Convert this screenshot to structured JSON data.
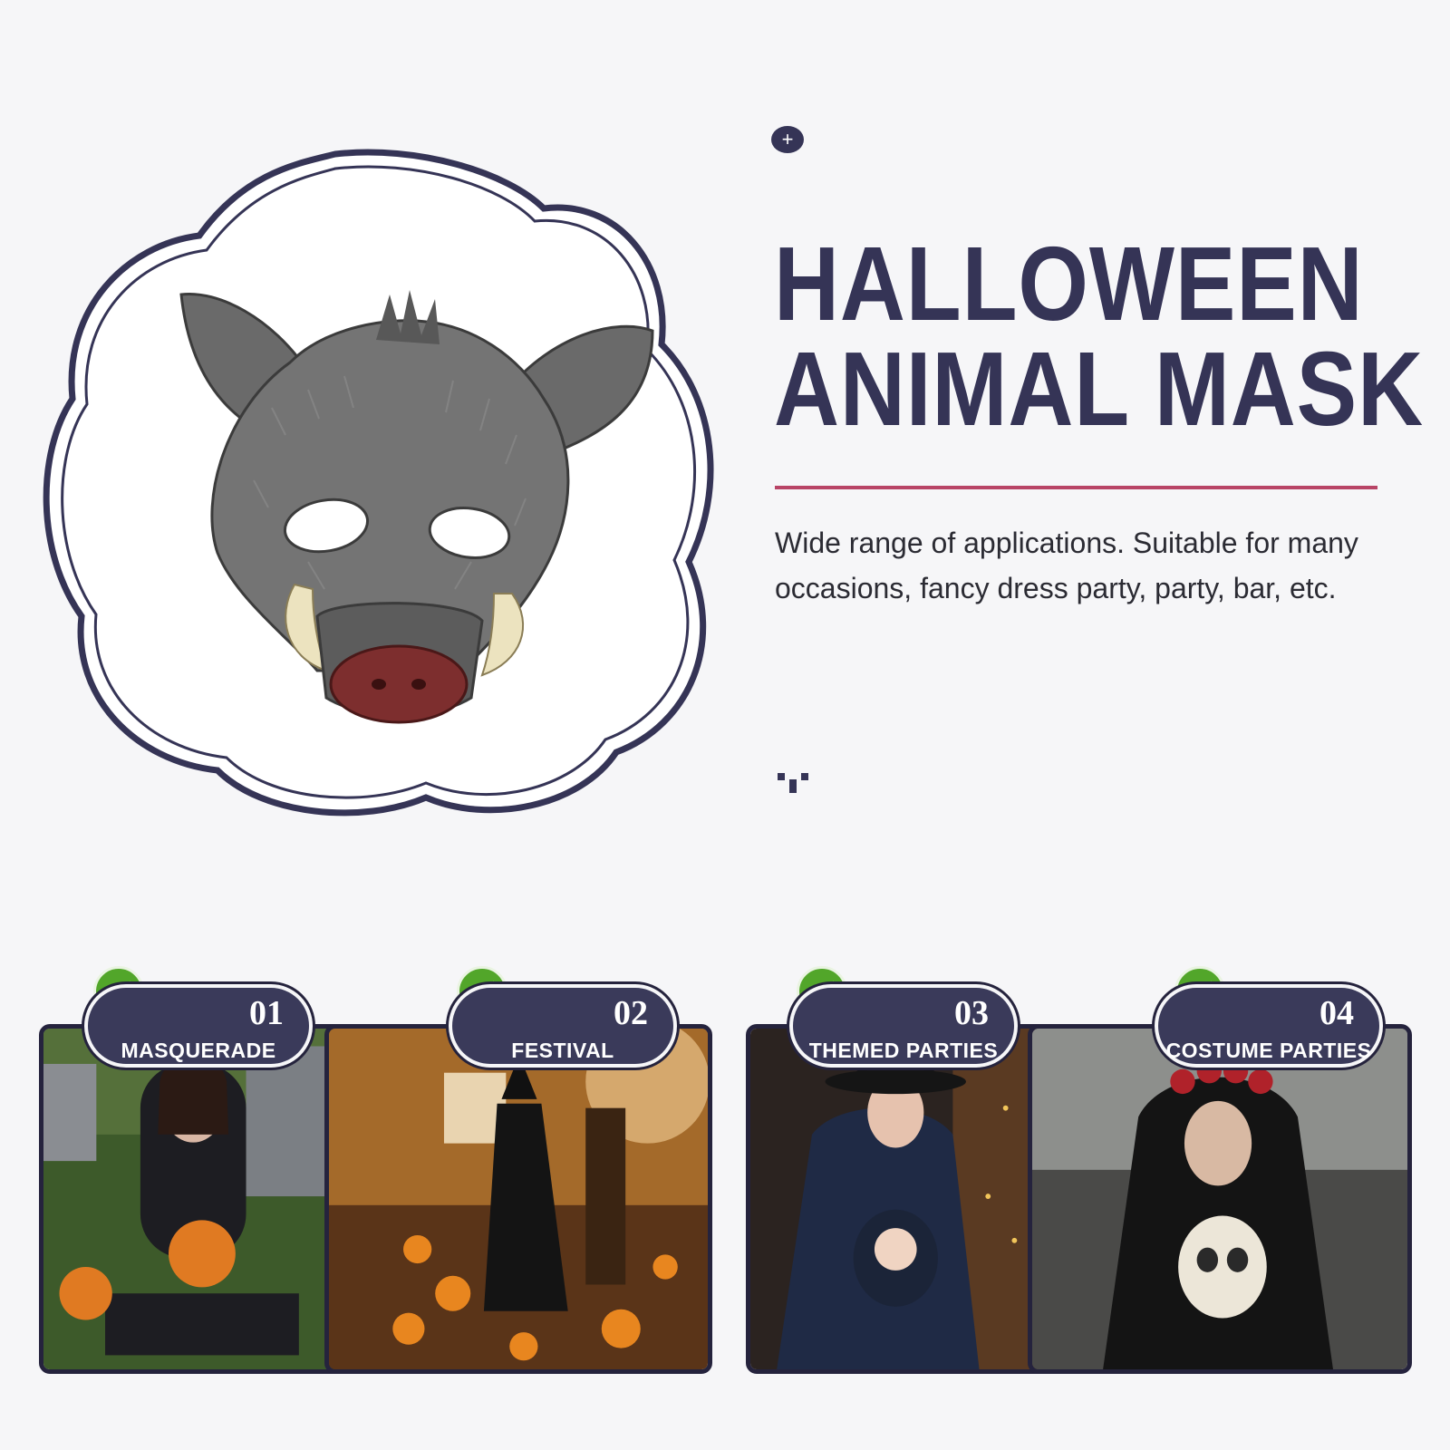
{
  "hero": {
    "title_line1": "HALLOWEEN",
    "title_line2": "ANIMAL MASK",
    "description": "Wide range of applications. Suitable for many occasions, fancy dress party, party, bar, etc.",
    "badge_icon": "plus-icon",
    "badge_symbol": "+",
    "product_image": "boar-mask-image"
  },
  "colors": {
    "accent": "#353456",
    "divider": "#b84466",
    "check": "#52a62a",
    "background": "#f6f6f8"
  },
  "cards": [
    {
      "number": "01",
      "label": "MASQUERADE",
      "icon": "check-icon",
      "image": "woman-with-pumpkin-photo"
    },
    {
      "number": "02",
      "label": "FESTIVAL",
      "icon": "check-icon",
      "image": "witch-in-pumpkin-forest-photo"
    },
    {
      "number": "03",
      "label": "THEMED PARTIES",
      "icon": "check-icon",
      "image": "witch-mother-with-baby-photo"
    },
    {
      "number": "04",
      "label": "COSTUME PARTIES",
      "icon": "check-icon",
      "image": "woman-with-skull-photo"
    }
  ]
}
